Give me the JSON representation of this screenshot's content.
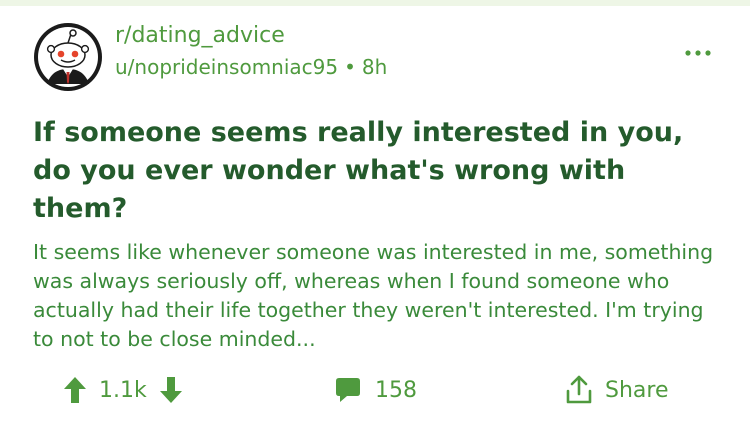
{
  "post": {
    "subreddit": "r/dating_advice",
    "author": "u/noprideinsomniac95",
    "separator": "•",
    "age": "8h",
    "title": "If someone seems really interested in you, do you ever wonder what's wrong with them?",
    "body": "It seems like whenever someone was interested in me, something was always seriously off, whereas when I found someone who actually had their life together they weren't interested. I'm trying to not to be close minded...",
    "avatar_icon": "reddit-snoo-icon",
    "more_icon": "more-options-icon"
  },
  "actions": {
    "upvote_icon": "arrow-up-icon",
    "score": "1.1k",
    "downvote_icon": "arrow-down-icon",
    "comment_icon": "comment-bubble-icon",
    "comments": "158",
    "share_icon": "share-icon",
    "share_label": "Share"
  },
  "colors": {
    "accent_green": "#4f9a3e",
    "title_green": "#245b2c",
    "body_green": "#3a8a3a",
    "snoo_eyes": "#e5442b"
  }
}
